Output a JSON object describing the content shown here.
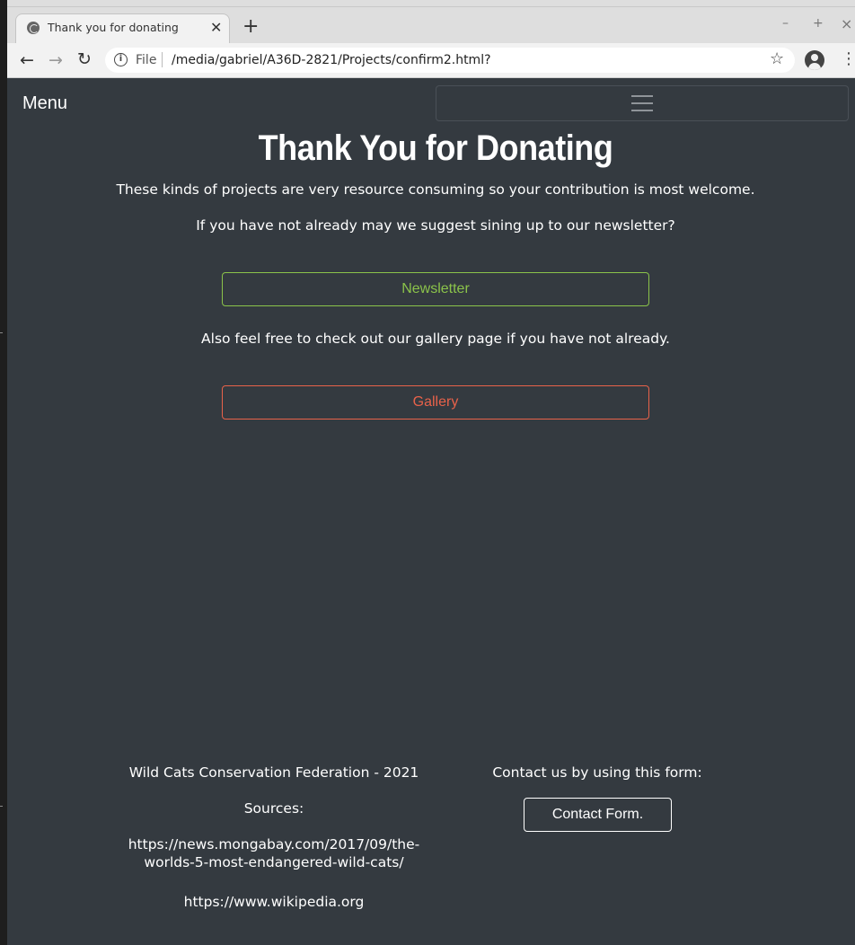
{
  "browser": {
    "tab_title": "Thank you for donating",
    "new_tab_symbol": "+",
    "scheme_label": "File",
    "url": "/media/gabriel/A36D-2821/Projects/confirm2.html?",
    "window_controls": {
      "minimize": "–",
      "maximize": "+",
      "close": "×"
    }
  },
  "navbar": {
    "brand": "Menu"
  },
  "main": {
    "heading": "Thank You for Donating",
    "paragraph_1": "These kinds of projects are very resource consuming so your contribution is most welcome.",
    "paragraph_2": "If you have not already may we suggest sining up to our newsletter?",
    "newsletter_button": "Newsletter",
    "paragraph_3": "Also feel free to check out our gallery page if you have not already.",
    "gallery_button": "Gallery"
  },
  "footer": {
    "org": "Wild Cats Conservation Federation - 2021",
    "sources_label": "Sources:",
    "source_1_line_1": "https://news.mongabay.com/2017/09/the-",
    "source_1_line_2": "worlds-5-most-endangered-wild-cats/",
    "source_2": "https://www.wikipedia.org",
    "contact_text": "Contact us by using this form:",
    "contact_button": "Contact Form."
  },
  "colors": {
    "page_background": "#343a40",
    "newsletter_accent": "#8bc34a",
    "gallery_accent": "#e8624a",
    "text": "#ffffff"
  }
}
